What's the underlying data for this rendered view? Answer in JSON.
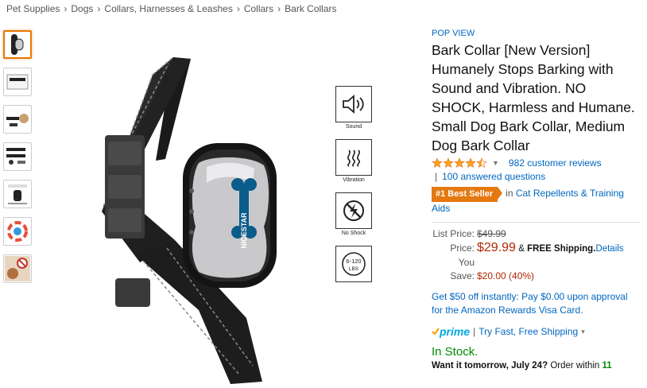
{
  "breadcrumb": [
    "Pet Supplies",
    "Dogs",
    "Collars, Harnesses & Leashes",
    "Collars",
    "Bark Collars"
  ],
  "breadcrumb_separator": "›",
  "thumbnails": [
    "product-front",
    "product-box",
    "dog-wearing",
    "kit-contents",
    "sensitivity-chart",
    "color-wheel",
    "no-shock-dog"
  ],
  "features": [
    {
      "icon": "speaker-icon",
      "label": "Sound"
    },
    {
      "icon": "vibration-icon",
      "label": "Vibration"
    },
    {
      "icon": "no-shock-icon",
      "label": "No Shock"
    },
    {
      "icon": "weight-icon",
      "label": "",
      "icon_text_top": "6-120",
      "icon_text_bottom": "LBS"
    }
  ],
  "product": {
    "brand": "POP VIEW",
    "title": "Bark Collar [New Version] Humanely Stops Barking with Sound and Vibration. NO SHOCK, Harmless and Humane. Small Dog Bark Collar, Medium Dog Bark Collar",
    "rating": 4.5,
    "reviews": "982 customer reviews",
    "answered": "100 answered questions",
    "bestseller_badge": "#1 Best Seller",
    "bestseller_in": "in",
    "bestseller_category": "Cat Repellents & Training Aids",
    "device_label": "NICESTAR"
  },
  "pricing": {
    "list_label": "List Price:",
    "list_price": "$49.99",
    "price_label": "Price:",
    "price": "$29.99",
    "shipping_prefix": "&",
    "shipping_bold": "FREE Shipping.",
    "details": "Details",
    "save_label": "You Save:",
    "savings": "$20.00 (40%)"
  },
  "promo": "Get $50 off instantly: Pay $0.00 upon approval for the Amazon Rewards Visa Card.",
  "prime": {
    "logo": "prime",
    "text": "Try Fast, Free Shipping",
    "caret": "▾"
  },
  "stock": "In Stock.",
  "delivery": {
    "bold": "Want it tomorrow, July 24?",
    "mid": "Order within",
    "time": "11"
  },
  "colors": {
    "link": "#0066c0",
    "price": "#b12704",
    "stock": "#008a00",
    "badge": "#e47911",
    "star": "#ffa41c"
  }
}
